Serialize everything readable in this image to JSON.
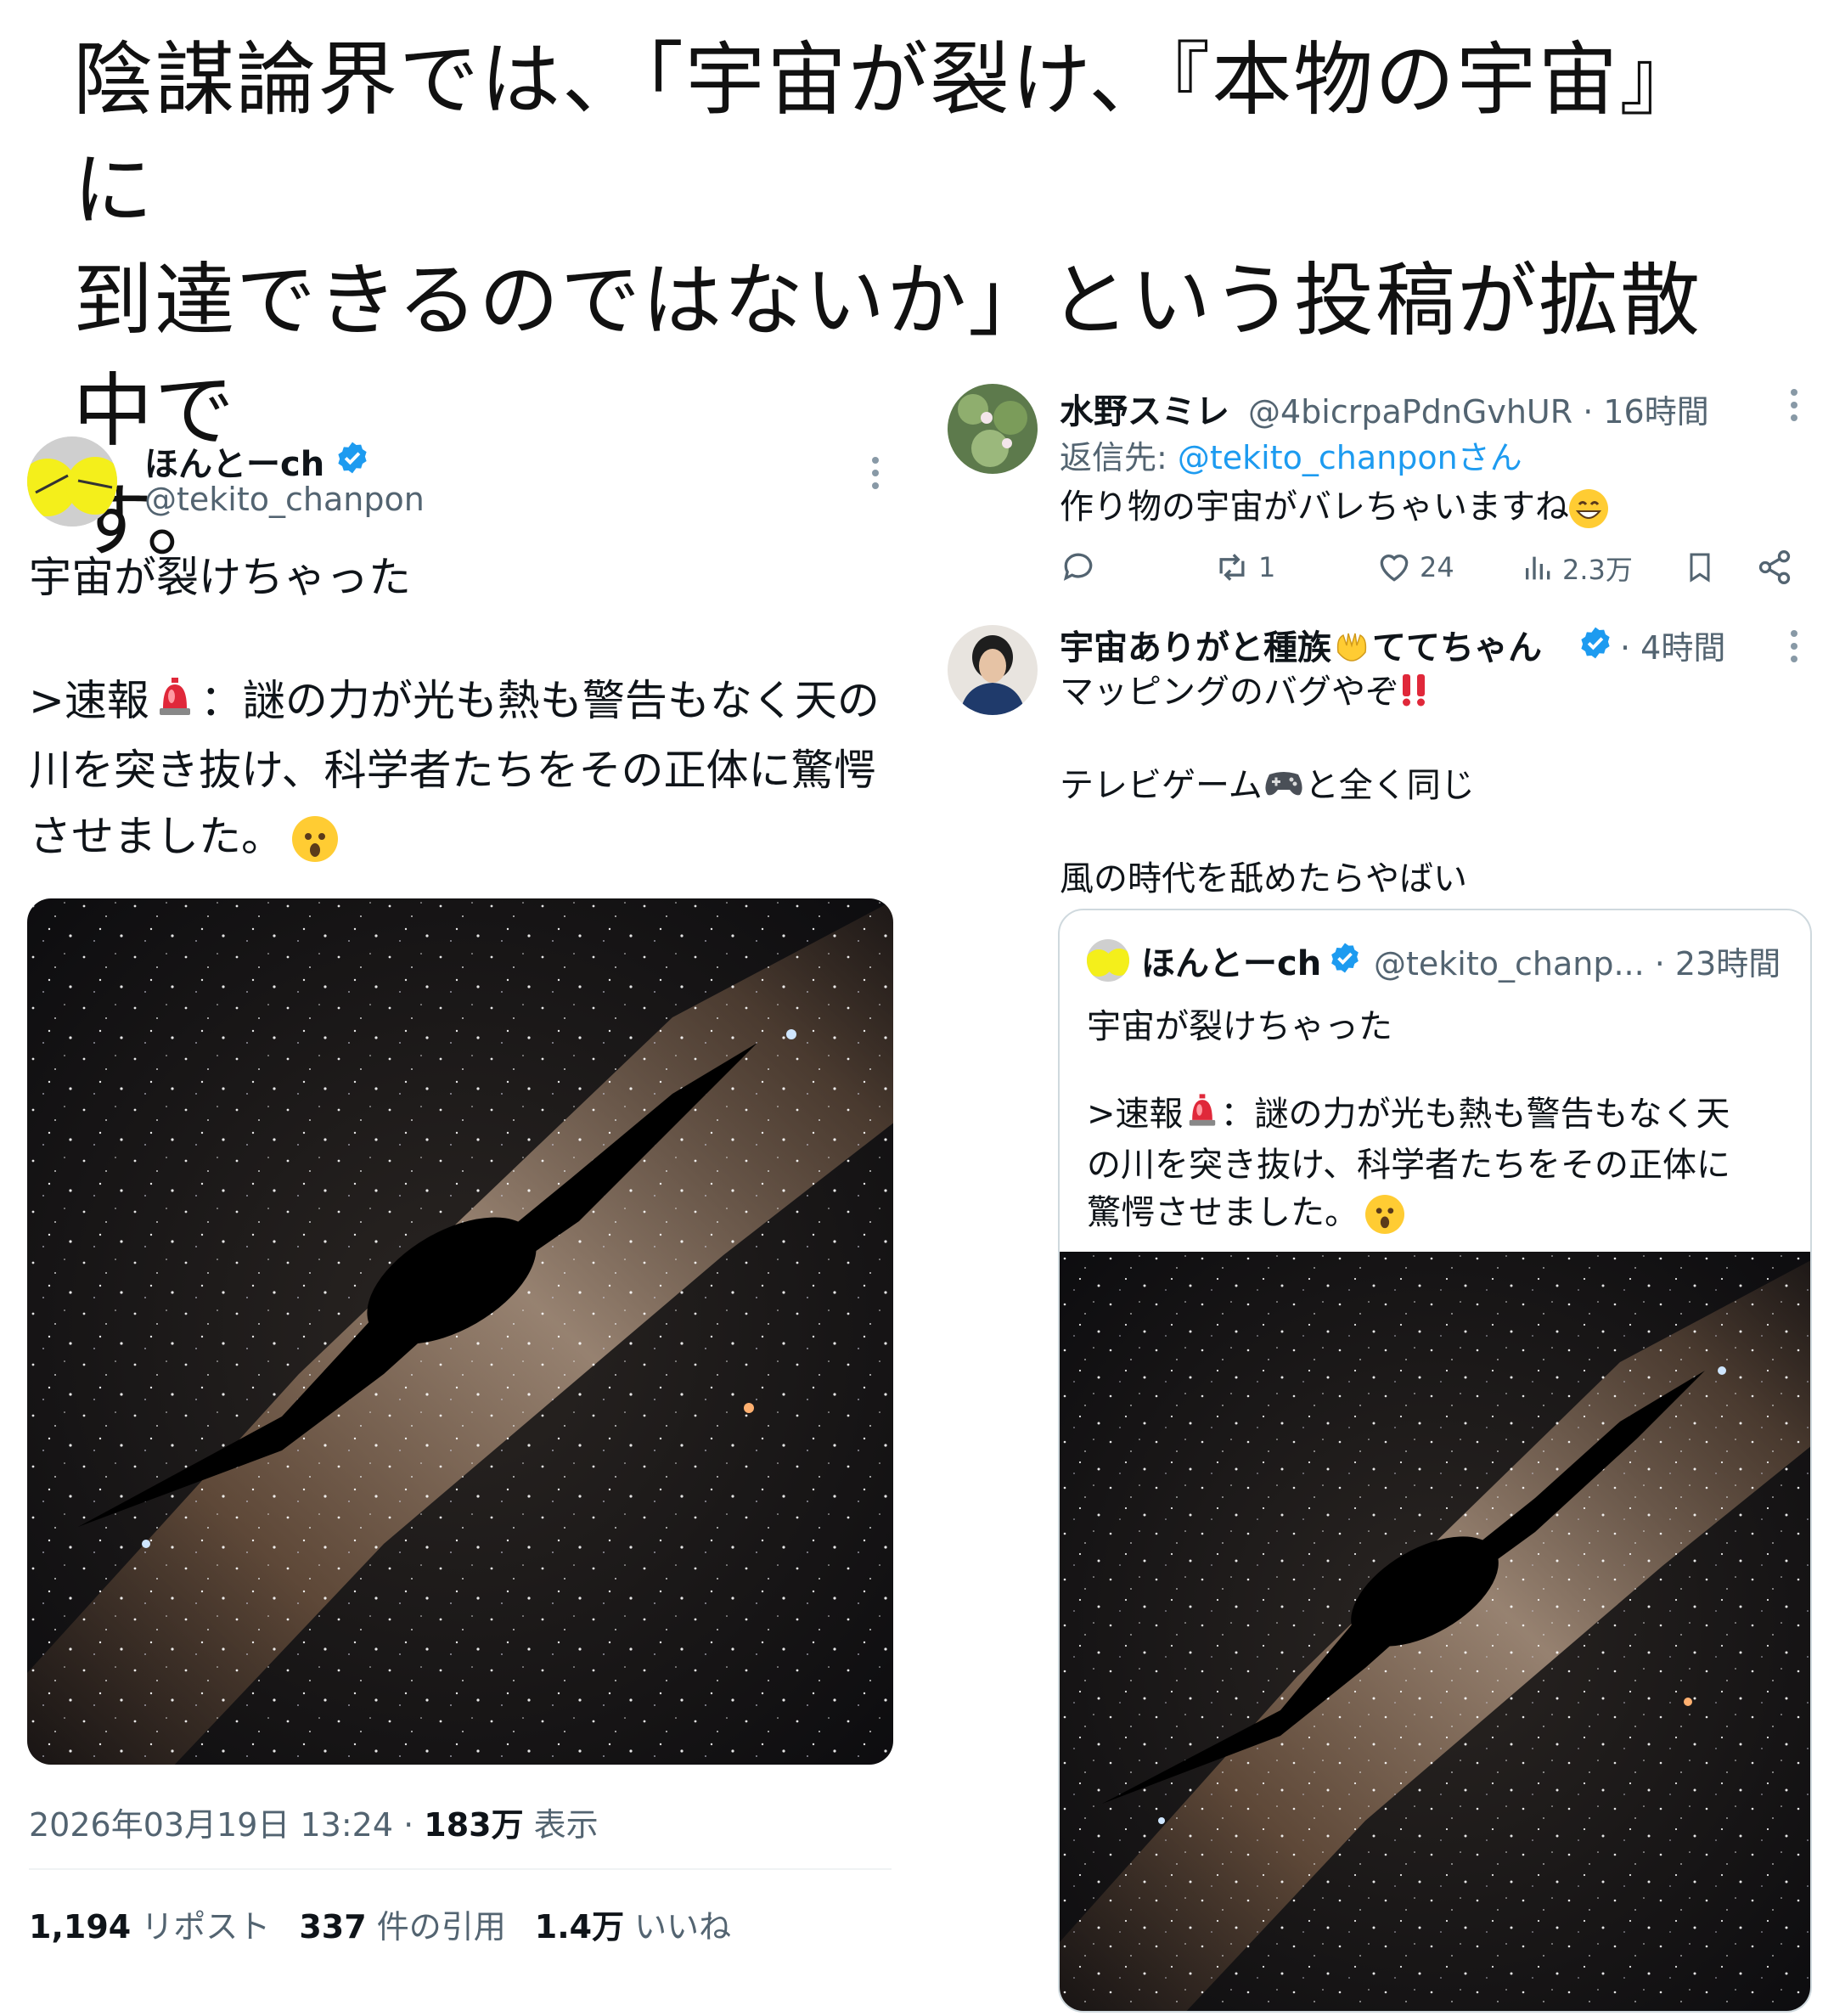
{
  "headline": "陰謀論界では、「宇宙が裂け、『本物の宇宙』に\n到達できるのではないか」という投稿が拡散中で\nす。",
  "main_tweet": {
    "display_name": "ほんとーch",
    "handle": "@tekito_chanpon",
    "text_line1": "宇宙が裂けちゃった",
    "text_body_prefix": ">速報",
    "text_body_rest": "：謎の力が光も熱も警告もなく天の\n川を突き抜け、科学者たちをその正体に驚愕\nさせました。",
    "timestamp": "2026年03月19日 13:24 · ",
    "views_count": "183万",
    "views_label": " 表示",
    "reposts_count": "1,194",
    "reposts_label": "リポスト",
    "quotes_count": "337",
    "quotes_label": "件の引用",
    "likes_count": "1.4万",
    "likes_label": "いいね"
  },
  "reply1": {
    "display_name": "水野スミレ",
    "handle_time": "@4bicrpaPdnGvhUR · 16時間",
    "reply_to_label": "返信先: ",
    "reply_to_handle": "@tekito_chanponさん",
    "text": "作り物の宇宙がバレちゃいますね",
    "retweets": "1",
    "likes": "24",
    "views": "2.3万"
  },
  "reply2": {
    "display_name_a": "宇宙ありがと種族",
    "display_name_b": "ててちゃん",
    "time": "· 4時間",
    "text_line1": "マッピングのバグやぞ",
    "text_line2_a": "テレビゲーム",
    "text_line2_b": "と全く同じ",
    "text_line3": "風の時代を舐めたらやばい"
  },
  "quoted_tweet": {
    "display_name": "ほんとーch",
    "handle_time": "@tekito_chanp... · 23時間",
    "text_line1": "宇宙が裂けちゃった",
    "text_body_prefix": ">速報",
    "text_body_rest": "：謎の力が光も熱も警告もなく天\nの川を突き抜け、科学者たちをその正体に\n驚愕させました。"
  },
  "colors": {
    "link": "#1d9bf0",
    "muted": "#536471",
    "verified": "#1d9bf0",
    "border": "#cfd9de"
  },
  "icons": [
    "verified-badge-icon",
    "more-options-icon",
    "reply-icon",
    "retweet-icon",
    "like-icon",
    "views-icon",
    "bookmark-icon",
    "share-icon",
    "siren-emoji-icon",
    "astonished-emoji-icon",
    "grin-emoji-icon",
    "hands-emoji-icon",
    "double-exclamation-emoji-icon",
    "gamepad-emoji-icon"
  ]
}
